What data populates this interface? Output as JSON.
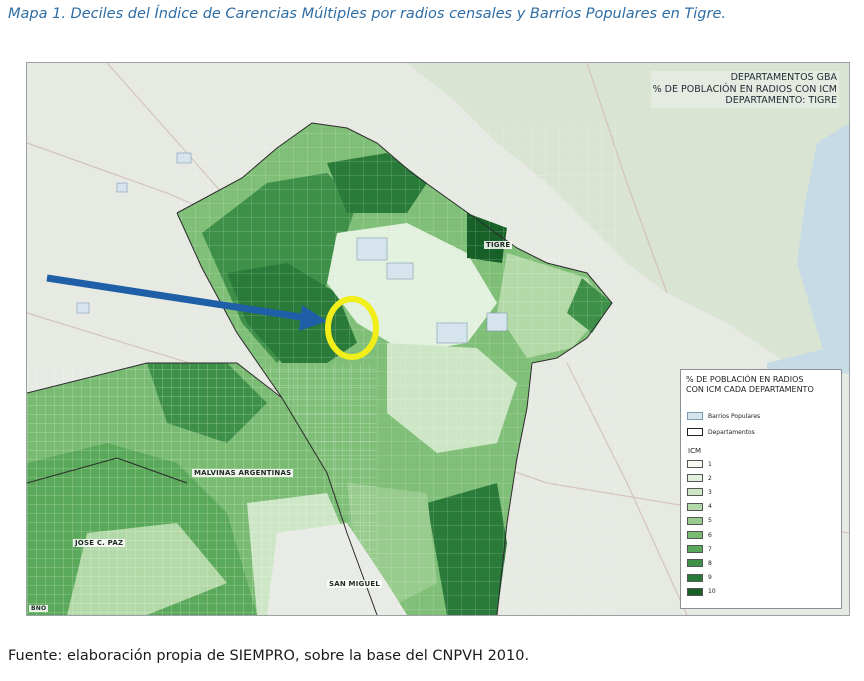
{
  "caption": "Mapa 1. Deciles del Índice de Carencias Múltiples por radios censales y Barrios Populares en Tigre.",
  "map_title": {
    "line1": "DEPARTAMENTOS GBA",
    "line2": "% DE POBLACIÓN EN RADIOS CON ICM",
    "line3": "DEPARTAMENTO: TIGRE"
  },
  "places": {
    "tigre": "TIGRE",
    "malvinas": "MALVINAS ARGENTINAS",
    "jose_c_paz": "JOSE C. PAZ",
    "san_miguel": "SAN MIGUEL",
    "bottom_left": "BNO"
  },
  "legend": {
    "title_line1": "% DE POBLACIÓN EN RADIOS",
    "title_line2": "CON ICM  CADA DEPARTAMENTO",
    "barrios_label": "Barrios Populares",
    "departamentos_label": "Departamentos",
    "icm_title": "ICM",
    "classes": [
      "1",
      "2",
      "3",
      "4",
      "5",
      "6",
      "7",
      "8",
      "9",
      "10"
    ],
    "class_colors": [
      "#f4f9f2",
      "#e2f1dd",
      "#cde6c5",
      "#b3d9a8",
      "#98cb8d",
      "#7abb73",
      "#5aa85a",
      "#3e9048",
      "#2a7a3a",
      "#176129"
    ],
    "barrios_color": "#d6e4ee"
  },
  "source": "Fuente: elaboración propia de SIEMPRO, sobre la base del CNPVH 2010."
}
